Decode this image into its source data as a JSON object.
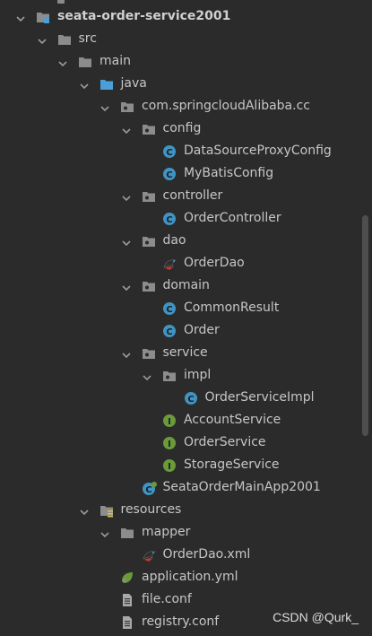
{
  "tree": [
    {
      "label": "seata-order-service2001",
      "type": "module",
      "expanded": true,
      "depth": 0
    },
    {
      "label": "src",
      "type": "folder",
      "expanded": true,
      "depth": 1
    },
    {
      "label": "main",
      "type": "folder",
      "expanded": true,
      "depth": 2
    },
    {
      "label": "java",
      "type": "source-root",
      "expanded": true,
      "depth": 3
    },
    {
      "label": "com.springcloudAlibaba.cc",
      "type": "package",
      "expanded": true,
      "depth": 4
    },
    {
      "label": "config",
      "type": "package",
      "expanded": true,
      "depth": 5
    },
    {
      "label": "DataSourceProxyConfig",
      "type": "class",
      "depth": 6
    },
    {
      "label": "MyBatisConfig",
      "type": "class",
      "depth": 6
    },
    {
      "label": "controller",
      "type": "package",
      "expanded": true,
      "depth": 5
    },
    {
      "label": "OrderController",
      "type": "class",
      "depth": 6
    },
    {
      "label": "dao",
      "type": "package",
      "expanded": true,
      "depth": 5
    },
    {
      "label": "OrderDao",
      "type": "mybatis-interface",
      "depth": 6
    },
    {
      "label": "domain",
      "type": "package",
      "expanded": true,
      "depth": 5
    },
    {
      "label": "CommonResult",
      "type": "class",
      "depth": 6
    },
    {
      "label": "Order",
      "type": "class",
      "depth": 6
    },
    {
      "label": "service",
      "type": "package",
      "expanded": true,
      "depth": 5
    },
    {
      "label": "impl",
      "type": "package",
      "expanded": true,
      "depth": 6
    },
    {
      "label": "OrderServiceImpl",
      "type": "class",
      "depth": 7
    },
    {
      "label": "AccountService",
      "type": "interface",
      "depth": 6
    },
    {
      "label": "OrderService",
      "type": "interface",
      "depth": 6
    },
    {
      "label": "StorageService",
      "type": "interface",
      "depth": 6
    },
    {
      "label": "SeataOrderMainApp2001",
      "type": "spring-boot-app",
      "depth": 5
    },
    {
      "label": "resources",
      "type": "resources-root",
      "expanded": true,
      "depth": 3
    },
    {
      "label": "mapper",
      "type": "folder",
      "expanded": true,
      "depth": 4
    },
    {
      "label": "OrderDao.xml",
      "type": "mybatis-xml",
      "depth": 5
    },
    {
      "label": "application.yml",
      "type": "yaml",
      "depth": 4
    },
    {
      "label": "file.conf",
      "type": "text-file",
      "depth": 4
    },
    {
      "label": "registry.conf",
      "type": "text-file",
      "depth": 4
    }
  ],
  "watermark": "CSDN @Qurk_",
  "colors": {
    "background": "#2b2b2b",
    "text": "#c6c6c6",
    "folder": "#8c8c8c",
    "source_root": "#4a9fd8",
    "class_circle": "#3f94c4",
    "interface_circle": "#6a9a3a"
  }
}
